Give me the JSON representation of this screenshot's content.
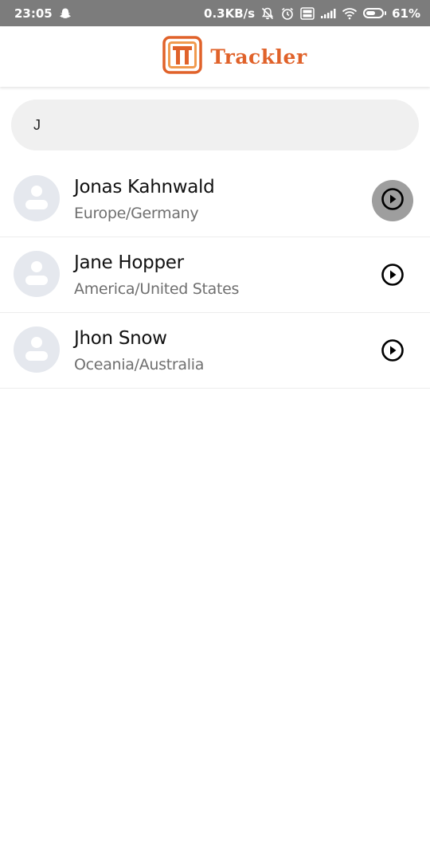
{
  "status_bar": {
    "time": "23:05",
    "network_speed": "0.3KB/s",
    "battery_percent": "61%",
    "battery_level": 0.61,
    "icons": [
      "snapchat-ghost-icon",
      "bell-off-icon",
      "alarm-icon",
      "volte-icon",
      "signal-icon",
      "wifi-icon",
      "battery-icon"
    ]
  },
  "header": {
    "logo_text": "Trackler",
    "brand_color": "#e0622a"
  },
  "search": {
    "value": "J",
    "placeholder": ""
  },
  "contacts": [
    {
      "name": "Jonas Kahnwald",
      "region": "Europe/Germany",
      "pressed": true
    },
    {
      "name": "Jane Hopper",
      "region": "America/United States",
      "pressed": false
    },
    {
      "name": "Jhon Snow",
      "region": "Oceania/Australia",
      "pressed": false
    }
  ]
}
